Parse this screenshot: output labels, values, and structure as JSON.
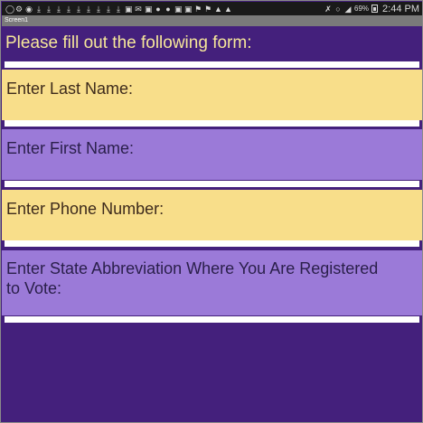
{
  "status_bar": {
    "left_icons": [
      "clock-alarm-icon",
      "settings-icon",
      "record-icon",
      "download-icon",
      "download-icon",
      "download-icon",
      "download-icon",
      "download-icon",
      "download-icon",
      "download-icon",
      "download-icon",
      "download-icon",
      "image-icon",
      "mail-icon",
      "photo-icon",
      "app-icon",
      "app-icon",
      "lock-icon",
      "image-icon",
      "flag-icon",
      "flag-icon",
      "warning-icon",
      "warning-icon"
    ],
    "battery": "69%",
    "time": "2:44 PM"
  },
  "title_bar": {
    "title": "Screen1"
  },
  "form": {
    "prompt": "Please fill out the following form:",
    "fields": [
      {
        "label": "Enter Last Name:"
      },
      {
        "label": "Enter First Name:"
      },
      {
        "label": "Enter Phone Number:"
      },
      {
        "label": "Enter State Abbreviation Where You Are Registered to Vote:"
      }
    ]
  },
  "colors": {
    "background": "#44207c",
    "band_yellow": "#f8de8a",
    "band_purple": "#9b7ad8",
    "prompt_text": "#f6e79a"
  }
}
